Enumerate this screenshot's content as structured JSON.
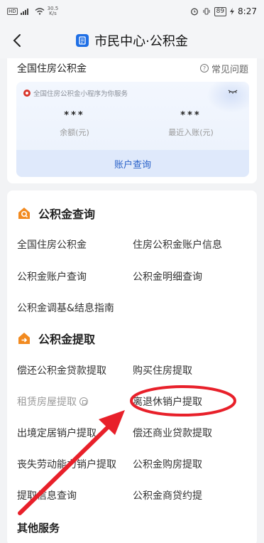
{
  "status_bar": {
    "hd": "HD",
    "speed_top": "30.5",
    "speed_bottom": "K/s",
    "battery": "89",
    "time": "8:27"
  },
  "nav": {
    "title": "市民中心·公积金",
    "logo_icon": "document-icon"
  },
  "account_card": {
    "title": "全国住房公积金",
    "faq_label": "常见问题",
    "mini_program_tip": "全国住房公积金小程序为你服务",
    "balance_value": "***",
    "balance_label": "余额(元)",
    "recent_value": "***",
    "recent_label": "最近入账(元)",
    "query_button": "账户查询"
  },
  "sections": {
    "query": {
      "title": "公积金查询",
      "items": [
        "全国住房公积金",
        "住房公积金账户信息",
        "公积金账户查询",
        "公积金明细查询",
        "公积金调基&结息指南"
      ]
    },
    "withdraw": {
      "title": "公积金提取",
      "items": [
        "偿还公积金贷款提取",
        "购买住房提取",
        "租赁房屋提取",
        "离退休销户提取",
        "出境定居销户提取",
        "偿还商业贷款提取",
        "丧失劳动能力销户提取",
        "公积金购房提取",
        "提取信息查询",
        "公积金商贷约提"
      ]
    },
    "other": {
      "title": "其他服务"
    }
  },
  "colors": {
    "accent_blue": "#2a62c9",
    "orange_icon": "#f28a1f",
    "annotation_red": "#e8202a"
  }
}
